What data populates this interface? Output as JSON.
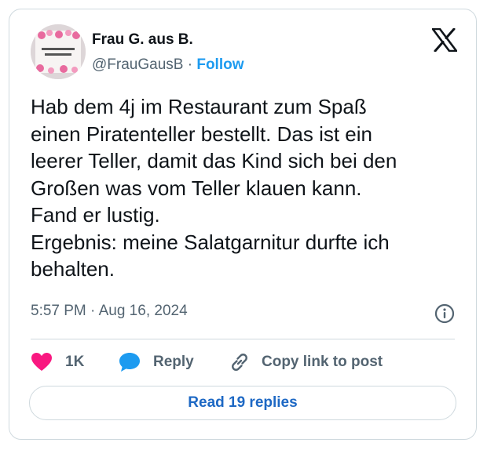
{
  "author": {
    "name": "Frau G. aus B.",
    "handle": "@FrauGausB",
    "separator": "·",
    "follow_label": "Follow"
  },
  "tweet": {
    "text": "Hab dem 4j im Restaurant zum Spaß\neinen Piratenteller bestellt. Das ist ein\nleerer Teller, damit das Kind sich bei den\nGroßen was vom Teller klauen kann.\nFand er lustig.\nErgebnis: meine Salatgarnitur durfte ich\nbehalten.",
    "time": "5:57 PM · Aug 16, 2024"
  },
  "actions": {
    "like_count": "1K",
    "reply_label": "Reply",
    "copy_label": "Copy link to post"
  },
  "read_replies_label": "Read 19 replies",
  "colors": {
    "like": "#f91880",
    "reply": "#1d9bf0",
    "link": "#1d9bf0",
    "muted": "#536471",
    "border": "#cfd9de"
  }
}
